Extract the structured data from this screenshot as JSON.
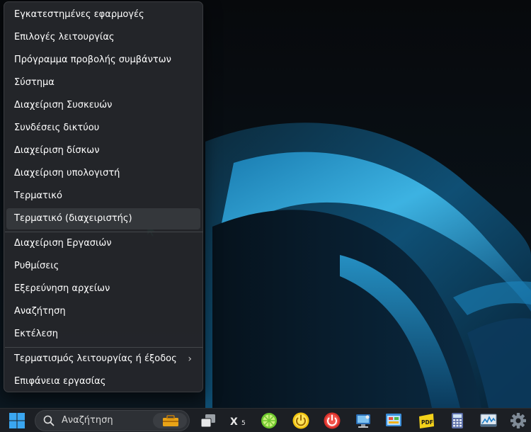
{
  "menu": {
    "items": [
      {
        "label": "Εγκατεστημένες εφαρμογές"
      },
      {
        "label": "Επιλογές λειτουργίας"
      },
      {
        "label": "Πρόγραμμα προβολής συμβάντων"
      },
      {
        "label": "Σύστημα"
      },
      {
        "label": "Διαχείριση Συσκευών"
      },
      {
        "label": "Συνδέσεις δικτύου"
      },
      {
        "label": "Διαχείριση δίσκων"
      },
      {
        "label": "Διαχείριση υπολογιστή"
      },
      {
        "label": "Τερματικό"
      },
      {
        "label": "Τερματικό (διαχειριστής)"
      },
      {
        "label": "Διαχείριση Εργασιών"
      },
      {
        "label": "Ρυθμίσεις"
      },
      {
        "label": "Εξερεύνηση αρχείων"
      },
      {
        "label": "Αναζήτηση"
      },
      {
        "label": "Εκτέλεση"
      },
      {
        "label": "Τερματισμός λειτουργίας ή έξοδος"
      },
      {
        "label": "Επιφάνεια εργασίας"
      }
    ],
    "submenu_chevron": "›"
  },
  "taskbar": {
    "search_label": "Αναζήτηση",
    "x5_label": "X",
    "x5_sub": "5",
    "pdf_label": "PDF",
    "icons": [
      "windows-start-icon",
      "search-icon",
      "briefcase-icon",
      "task-view-icon",
      "x5-app-icon",
      "lime-app-icon",
      "power-yellow-icon",
      "power-red-icon",
      "computer-app-icon",
      "control-panel-icon",
      "pdf-app-icon",
      "calculator-icon",
      "resource-monitor-icon",
      "settings-gear-icon"
    ]
  },
  "colors": {
    "menu_bg": "#24262a",
    "hover_bg": "#34373b",
    "accent": "#1ba1e2",
    "cursor": "#2ee6a8"
  }
}
